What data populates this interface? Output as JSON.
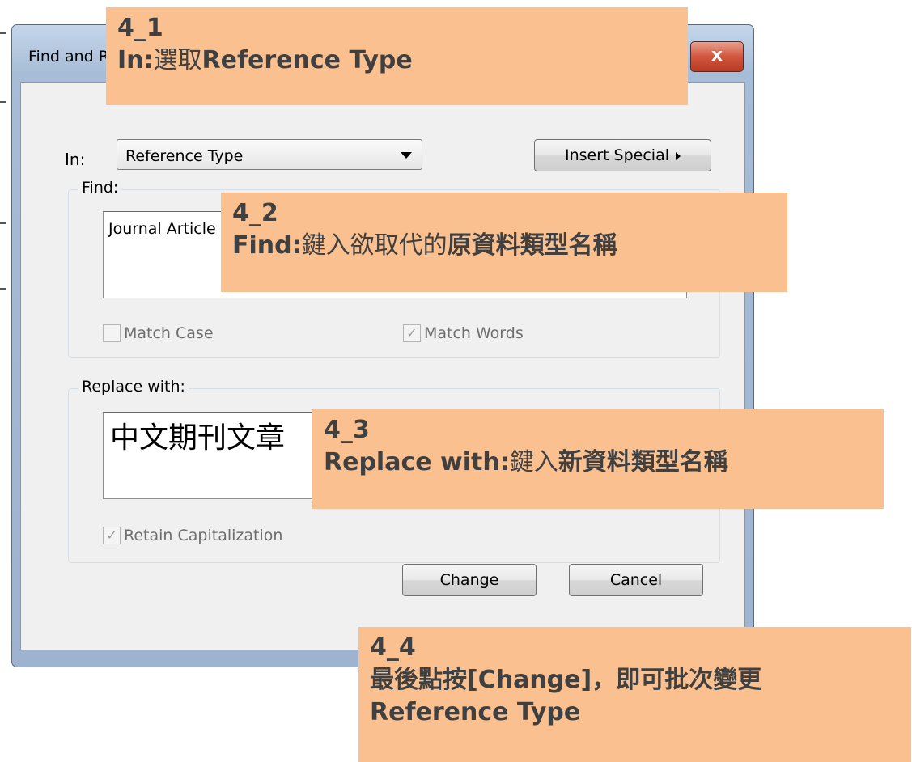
{
  "dialog": {
    "title": "Find and Replace",
    "close_glyph": "x",
    "in_label": "In:",
    "in_select_value": "Reference Type",
    "insert_special_label": "Insert Special",
    "find_group_label": "Find:",
    "find_value": "Journal Article",
    "match_case_label": "Match Case",
    "match_words_label": "Match Words",
    "replace_group_label": "Replace with:",
    "replace_value": "中文期刊文章",
    "retain_cap_label": "Retain Capitalization",
    "change_label": "Change",
    "cancel_label": "Cancel"
  },
  "notes": [
    {
      "num": "4_1",
      "bold1": "In:",
      "plain": "選取",
      "bold2": "Reference Type"
    },
    {
      "num": "4_2",
      "bold1": "Find:",
      "plain": "鍵入欲取代的",
      "bold2": "原資料類型名稱"
    },
    {
      "num": "4_3",
      "bold1": "Replace with:",
      "plain": "鍵入",
      "bold2": "新資料類型名稱"
    },
    {
      "num": "4_4",
      "line1": "最後點按[Change]，即可批次變更",
      "line2": "Reference Type"
    }
  ],
  "colors": {
    "callout": "#fac090",
    "callout_text": "#404040",
    "close_button": "#c9452e",
    "dialog_frame": "#a7bcd6"
  }
}
